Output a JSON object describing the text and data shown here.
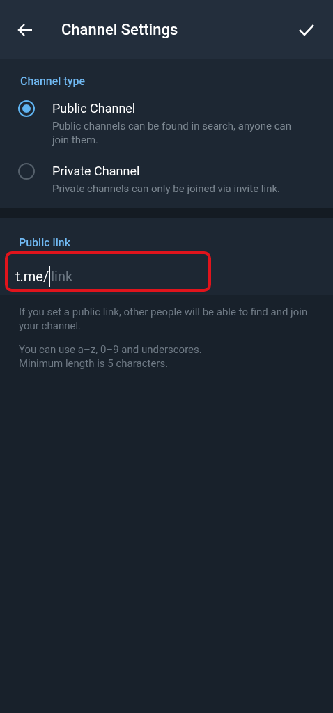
{
  "header": {
    "title": "Channel Settings"
  },
  "channel_type": {
    "heading": "Channel type",
    "options": [
      {
        "label": "Public Channel",
        "description": "Public channels can be found in search, anyone can join them.",
        "selected": true
      },
      {
        "label": "Private Channel",
        "description": "Private channels can only be joined via invite link.",
        "selected": false
      }
    ]
  },
  "public_link": {
    "heading": "Public link",
    "prefix": "t.me/",
    "placeholder": "link",
    "highlighted": true
  },
  "hints": [
    "If you set a public link, other people will be able to find and join your channel.",
    "You can use a–z, 0–9 and underscores.\nMinimum length is 5 characters."
  ]
}
